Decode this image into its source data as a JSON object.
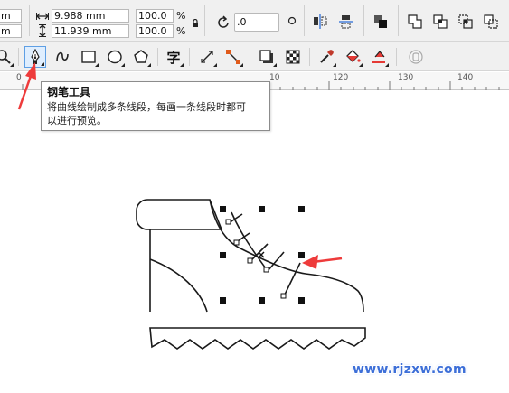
{
  "propertybar": {
    "x_partial": "m",
    "y_partial": "m",
    "width_value": "9.988 mm",
    "height_value": "11.939 mm",
    "scale_x": "100.0",
    "scale_y": "100.0",
    "percent_x": "%",
    "percent_y": "%",
    "rotation_value": ".0"
  },
  "ruler": {
    "ticks": [
      "0",
      "10",
      "120",
      "130",
      "140"
    ]
  },
  "tooltip": {
    "title": "钢笔工具",
    "desc_line1": "将曲线绘制成多条线段，每画一条线段时都可",
    "desc_line2": "以进行预览。"
  },
  "toolbox": {
    "text_tool_glyph": "字"
  },
  "watermark": {
    "text": "www.rjzxw.com"
  },
  "colors": {
    "accent_red": "#ee3b3b",
    "watermark_blue": "#3d6fd8",
    "active_tool_border": "#5e9fe4"
  },
  "icons": [
    "zoom-icon",
    "pen-icon",
    "bspline-icon",
    "rectangle-icon",
    "ellipse-icon",
    "polygon-icon",
    "text-icon",
    "connector-icon",
    "dimension-icon",
    "shadow-icon",
    "transparency-icon",
    "eyedropper-icon",
    "fill-icon",
    "smart-fill-icon",
    "lock-icon",
    "rotate-icon",
    "mirror-h-icon",
    "mirror-v-icon",
    "arrange-icon",
    "weld-icon",
    "trim-icon",
    "intersect-icon",
    "simplify-icon"
  ]
}
